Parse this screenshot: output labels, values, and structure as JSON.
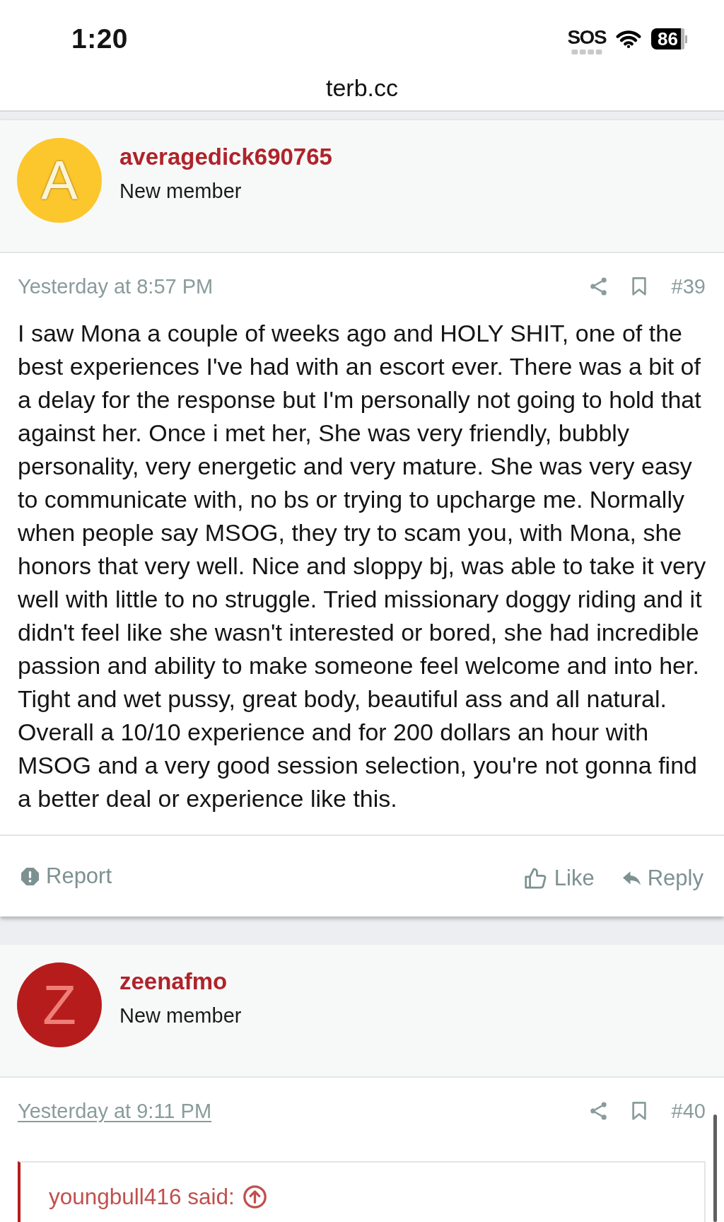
{
  "status_bar": {
    "time": "1:20",
    "sos": "SOS",
    "battery": "86"
  },
  "address_bar": {
    "url": "terb.cc"
  },
  "posts": [
    {
      "color": "#fcc72c",
      "avatar_letter": "A",
      "username": "averagedick690765",
      "user_title": "New member",
      "date": "Yesterday at 8:57 PM",
      "date_underlined": false,
      "post_number": "#39",
      "body": "I saw Mona a couple of weeks ago and HOLY SHIT, one of the best experiences I've had with an escort ever. There was a bit of a delay for the response but I'm personally not going to hold that against her. Once i met her, She was very friendly, bubbly personality, very energetic and very mature. She was very easy to communicate with, no bs or trying to upcharge me. Normally when people say MSOG, they try to scam you, with Mona, she honors that very well. Nice and sloppy bj, was able to take it very well with little to no struggle. Tried missionary doggy riding and it didn't feel like she wasn't interested or bored, she had incredible passion and ability to make someone feel welcome and into her. Tight and wet pussy, great body, beautiful ass and all natural. Overall a 10/10 experience and for 200 dollars an hour with MSOG and a very good session selection, you're not gonna find a better deal or experience like this.",
      "actions": [
        {
          "kind": "report",
          "label": "Report"
        },
        {
          "kind": "like",
          "label": "Like"
        },
        {
          "kind": "reply",
          "label": "Reply"
        }
      ]
    },
    {
      "color": "#b71c1c",
      "avatar_letter": "Z",
      "username": "zeenafmo",
      "user_title": "New member",
      "date": "Yesterday at 9:11 PM",
      "date_underlined": true,
      "post_number": "#40",
      "quote": {
        "attribution": "youngbull416 said:"
      }
    }
  ]
}
